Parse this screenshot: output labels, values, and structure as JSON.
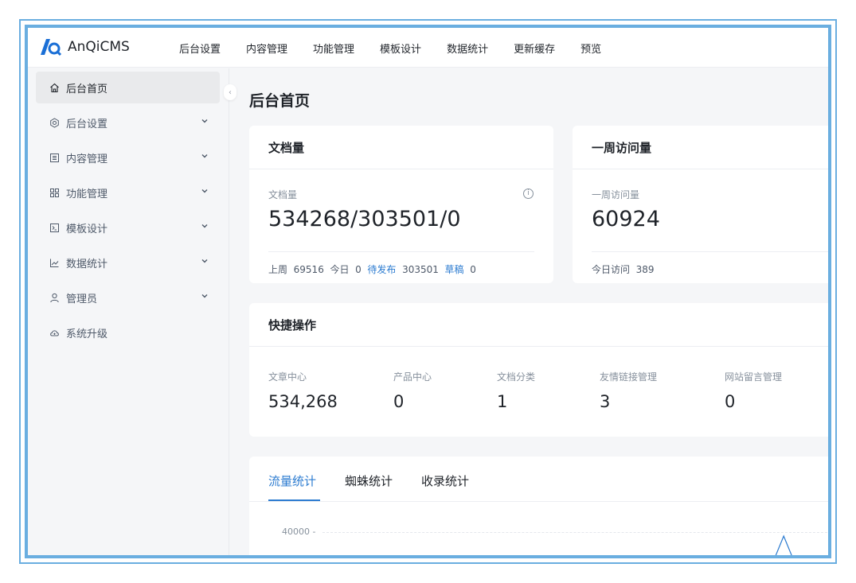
{
  "app": {
    "logo_text": "AnQiCMS",
    "accent_color": "#2b7bd0",
    "logo_color": "#1a6fd6"
  },
  "topnav": {
    "items": [
      {
        "label": "后台设置"
      },
      {
        "label": "内容管理"
      },
      {
        "label": "功能管理"
      },
      {
        "label": "模板设计"
      },
      {
        "label": "数据统计"
      },
      {
        "label": "更新缓存"
      },
      {
        "label": "预览"
      }
    ]
  },
  "sidebar": {
    "items": [
      {
        "label": "后台首页",
        "icon": "home-icon",
        "active": true
      },
      {
        "label": "后台设置",
        "icon": "gear-icon",
        "expandable": true
      },
      {
        "label": "内容管理",
        "icon": "document-list-icon",
        "expandable": true
      },
      {
        "label": "功能管理",
        "icon": "grid-icon",
        "expandable": true
      },
      {
        "label": "模板设计",
        "icon": "terminal-icon",
        "expandable": true
      },
      {
        "label": "数据统计",
        "icon": "line-chart-icon",
        "expandable": true
      },
      {
        "label": "管理员",
        "icon": "user-icon",
        "expandable": true
      },
      {
        "label": "系统升级",
        "icon": "cloud-upload-icon"
      }
    ]
  },
  "page": {
    "title": "后台首页"
  },
  "doc_card": {
    "title": "文档量",
    "stat_label": "文档量",
    "stat_value": "534268/303501/0",
    "footer": {
      "last_week_label": "上周",
      "last_week_value": "69516",
      "today_label": "今日",
      "today_value": "0",
      "pending_label": "待发布",
      "pending_value": "303501",
      "draft_label": "草稿",
      "draft_value": "0"
    }
  },
  "visit_card": {
    "title": "一周访问量",
    "stat_label": "一周访问量",
    "stat_value": "60924",
    "footer": {
      "today_label": "今日访问",
      "today_value": "389"
    }
  },
  "quick_actions": {
    "title": "快捷操作",
    "items": [
      {
        "label": "文章中心",
        "value": "534,268"
      },
      {
        "label": "产品中心",
        "value": "0"
      },
      {
        "label": "文档分类",
        "value": "1"
      },
      {
        "label": "友情链接管理",
        "value": "3"
      },
      {
        "label": "网站留言管理",
        "value": "0"
      }
    ]
  },
  "stats_tabs": {
    "tabs": [
      {
        "label": "流量统计",
        "active": true
      },
      {
        "label": "蜘蛛统计"
      },
      {
        "label": "收录统计"
      }
    ]
  },
  "chart_data": {
    "type": "line",
    "title": "",
    "xlabel": "",
    "ylabel": "",
    "y_ticks": [
      "40000 -"
    ],
    "series": [
      {
        "values": [
          0,
          0,
          0,
          0,
          0,
          0,
          0,
          0,
          0,
          0,
          0,
          0,
          0,
          0,
          0,
          38000,
          0,
          0,
          0,
          0
        ]
      }
    ],
    "line_color": "#2b7bd0",
    "grid": true
  }
}
